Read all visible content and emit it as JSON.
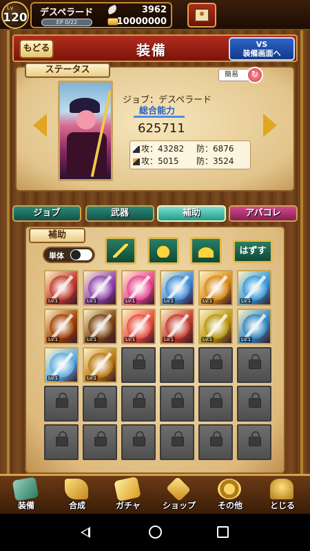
{
  "player": {
    "level_label": "Lv",
    "level": "120",
    "name": "デスペラード",
    "ep_text": "EP 0/22",
    "ep_progress": 0.0,
    "feathers": "3962",
    "gold": "10000000"
  },
  "header": {
    "back_label": "もどる",
    "title": "装備",
    "vs_line1": "VS",
    "vs_line2": "装備画面へ"
  },
  "status": {
    "tag": "ステータス",
    "simple_label": "簡易",
    "job": "ジョブ：デスペラード",
    "total_label": "総合能力",
    "total_value": "625711",
    "phys_atk": "攻：43282",
    "phys_def": "防：6876",
    "mag_atk": "攻：5015",
    "mag_def": "防：3524"
  },
  "tabs": [
    {
      "label": "ジョブ",
      "active": false
    },
    {
      "label": "武器",
      "active": false
    },
    {
      "label": "補助",
      "active": true
    },
    {
      "label": "アバコレ",
      "active": false
    }
  ],
  "support": {
    "tag": "補助",
    "single_label": "単体",
    "remove_label": "はずす"
  },
  "items": {
    "level_text": "Lv.1",
    "colors": [
      "#c0392b",
      "#8e44ad",
      "#e84393",
      "#3d8bd9",
      "#d68910",
      "#3498db",
      "#a04000",
      "#784212",
      "#e74c3c",
      "#c0392b",
      "#b7950b",
      "#2e86c1",
      "#5dade2",
      "#b9770e"
    ]
  },
  "nav": [
    {
      "label": "装備",
      "icon": "equip-icon"
    },
    {
      "label": "合成",
      "icon": "hammer-icon"
    },
    {
      "label": "ガチャ",
      "icon": "gacha-icon"
    },
    {
      "label": "ショップ",
      "icon": "shop-icon"
    },
    {
      "label": "その他",
      "icon": "gear-icon"
    },
    {
      "label": "とじる",
      "icon": "close-icon"
    }
  ]
}
